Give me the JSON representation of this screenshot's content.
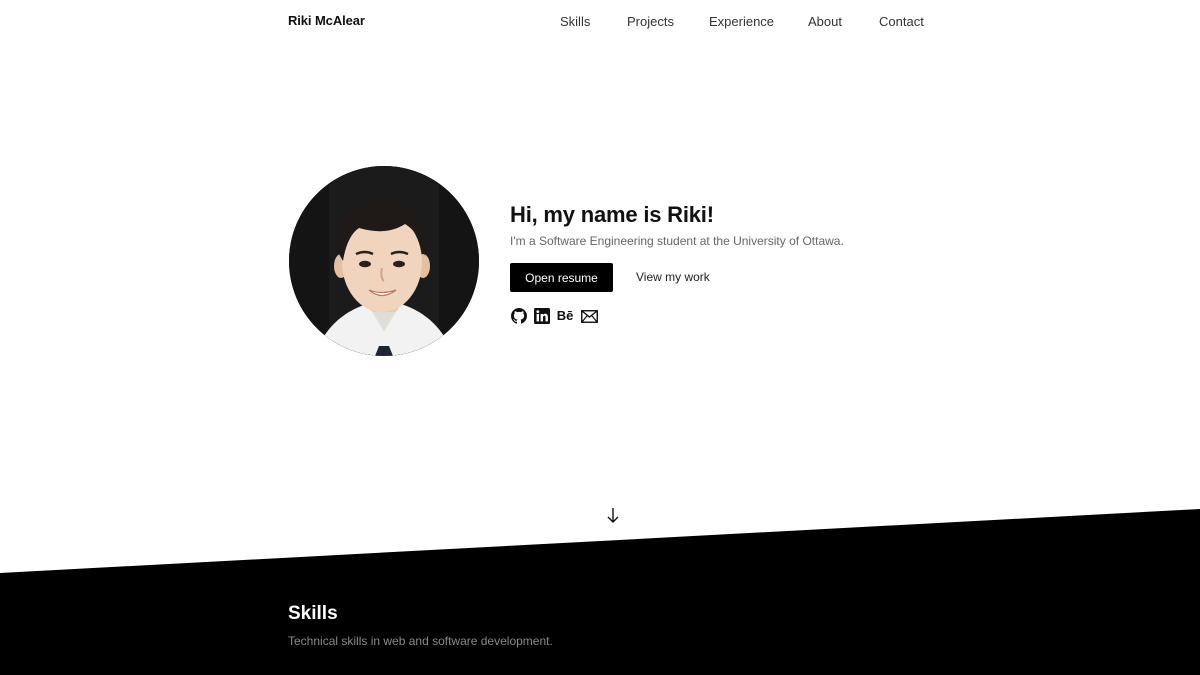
{
  "nav": {
    "brand": "Riki McAlear",
    "links": [
      "Skills",
      "Projects",
      "Experience",
      "About",
      "Contact"
    ]
  },
  "hero": {
    "title": "Hi, my name is Riki!",
    "subtitle": "I'm a Software Engineering student at the University of Ottawa.",
    "primary_button": "Open resume",
    "secondary_link": "View my work",
    "socials": [
      {
        "icon": "github-icon"
      },
      {
        "icon": "linkedin-icon"
      },
      {
        "icon": "behance-icon",
        "text": "Bē"
      },
      {
        "icon": "mail-icon"
      }
    ]
  },
  "skills": {
    "title": "Skills",
    "subtitle": "Technical skills in web and software development."
  },
  "colors": {
    "background": "#ffffff",
    "accent": "#000000",
    "muted_text": "#666666"
  }
}
